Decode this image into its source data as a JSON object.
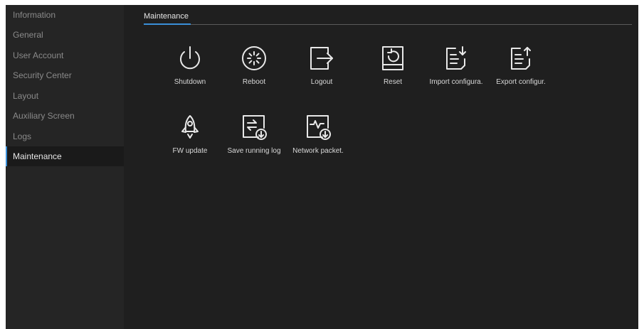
{
  "sidebar": {
    "items": [
      {
        "label": "Information"
      },
      {
        "label": "General"
      },
      {
        "label": "User Account"
      },
      {
        "label": "Security Center"
      },
      {
        "label": "Layout"
      },
      {
        "label": "Auxiliary Screen"
      },
      {
        "label": "Logs"
      },
      {
        "label": "Maintenance",
        "active": true
      }
    ]
  },
  "main": {
    "tab": "Maintenance",
    "tiles": [
      {
        "label": "Shutdown",
        "icon": "power-icon"
      },
      {
        "label": "Reboot",
        "icon": "reboot-icon"
      },
      {
        "label": "Logout",
        "icon": "logout-icon"
      },
      {
        "label": "Reset",
        "icon": "reset-icon"
      },
      {
        "label": "Import configura.",
        "icon": "import-config-icon"
      },
      {
        "label": "Export configur.",
        "icon": "export-config-icon"
      },
      {
        "label": "FW update",
        "icon": "rocket-icon"
      },
      {
        "label": "Save running log",
        "icon": "save-log-icon"
      },
      {
        "label": "Network packet.",
        "icon": "network-packet-icon"
      }
    ]
  },
  "colors": {
    "background": "#1f1f1f",
    "sidebar": "#252525",
    "accent": "#3a8fd8",
    "text": "#e6e6e6",
    "muted_text": "#8a8a8a"
  }
}
